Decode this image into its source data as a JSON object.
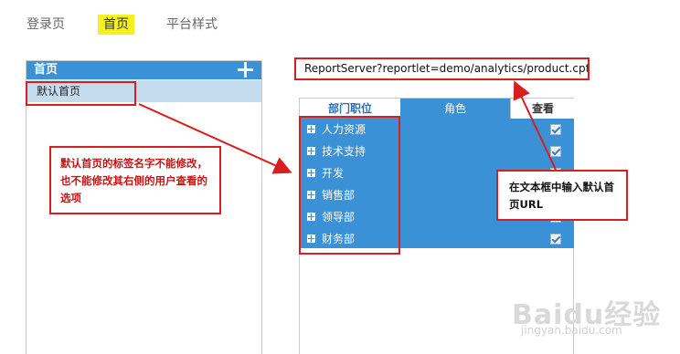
{
  "top_tabs": [
    {
      "label": "登录页"
    },
    {
      "label": "首页"
    },
    {
      "label": "平台样式"
    }
  ],
  "left_panel": {
    "header": "首页",
    "item": "默认首页"
  },
  "url_input": {
    "value": "ReportServer?reportlet=demo/analytics/product.cpt"
  },
  "right_panel": {
    "tabs": [
      "部门职位",
      "角色",
      "查看"
    ],
    "rows": [
      "人力资源",
      "技术支持",
      "开发",
      "销售部",
      "领导部",
      "财务部"
    ]
  },
  "annotations": {
    "left_note": "默认首页的标签名字不能修改，也不能修改其右侧的用户查看的选项",
    "right_note": "在文本框中输入默认首页URL"
  },
  "watermark": {
    "logo": "Baidu经验",
    "url": "jingyan.baidu.com"
  },
  "colors": {
    "accent": "#3a91d6",
    "highlight": "#f5f021",
    "annotation_red": "#d81e1e"
  }
}
